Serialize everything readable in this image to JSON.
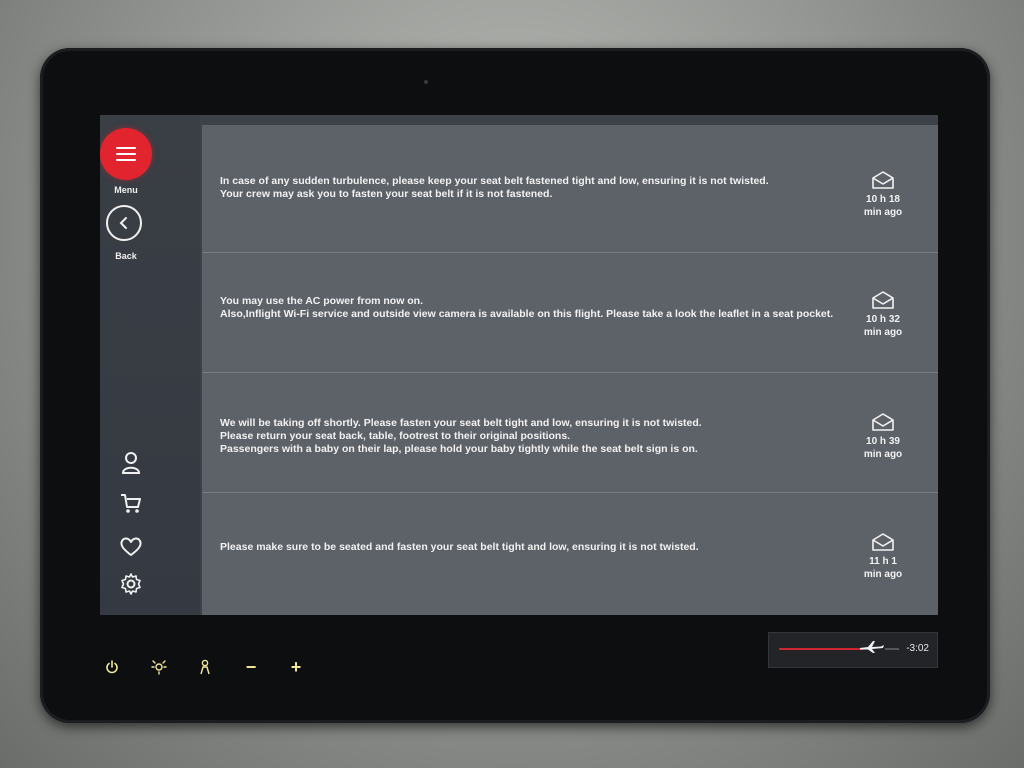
{
  "sidebar": {
    "menu_label": "Menu",
    "back_label": "Back",
    "icons": [
      "profile-icon",
      "cart-icon",
      "heart-icon",
      "settings-icon"
    ]
  },
  "messages": [
    {
      "lines": [
        "In case of any sudden turbulence, please keep your seat belt fastened tight and low, ensuring it is not twisted.",
        "Your crew may ask you to fasten your seat belt if it is not fastened."
      ],
      "time": "10 h 18",
      "ago": "min ago"
    },
    {
      "lines": [
        "You may use the AC power from now on.",
        "Also,Inflight Wi-Fi service and outside view camera is available on this flight. Please take a look the leaflet in a seat pocket."
      ],
      "time": "10 h 32",
      "ago": "min ago"
    },
    {
      "lines": [
        "We will be taking off shortly. Please fasten your seat belt tight and low, ensuring it is not twisted.",
        "Please return your seat back, table, footrest to their original positions.",
        "Passengers with a baby on their lap, please hold your baby tightly while the seat belt sign is on."
      ],
      "time": "10 h 39",
      "ago": "min ago"
    },
    {
      "lines": [
        "Please make sure to be seated and fasten your seat belt tight and low, ensuring it is not twisted."
      ],
      "time": "11 h 1",
      "ago": "min ago"
    }
  ],
  "hardware_controls": {
    "minus": "−",
    "plus": "+",
    "icons": [
      "power-icon",
      "reading-light-icon",
      "call-attendant-icon"
    ]
  },
  "flight_status": {
    "time_remaining": "-3:02",
    "progress": 0.7
  },
  "colors": {
    "accent": "#e2242f",
    "hardware_icon": "#f3e79a"
  }
}
